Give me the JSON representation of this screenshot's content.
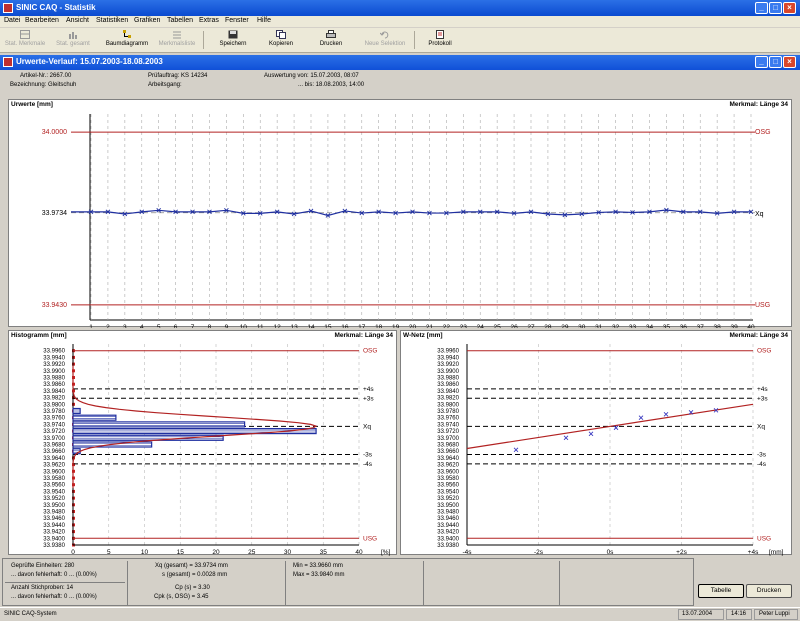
{
  "window": {
    "title": "SINIC CAQ - Statistik"
  },
  "menu": [
    "Datei",
    "Bearbeiten",
    "Ansicht",
    "Statistiken",
    "Grafiken",
    "Tabellen",
    "Extras",
    "Fenster",
    "Hilfe"
  ],
  "toolbar": [
    {
      "label": "Stat. Merkmale",
      "enabled": false,
      "icon": "table-icon"
    },
    {
      "label": "Stat. gesamt",
      "enabled": false,
      "icon": "chart-icon"
    },
    {
      "label": "Baumdiagramm",
      "enabled": true,
      "icon": "tree-icon"
    },
    {
      "label": "Merkmalsliste",
      "enabled": false,
      "icon": "list-icon"
    },
    {
      "label": "Speichern",
      "enabled": true,
      "icon": "save-icon"
    },
    {
      "label": "Kopieren",
      "enabled": true,
      "icon": "copy-icon"
    },
    {
      "label": "Drucken",
      "enabled": true,
      "icon": "print-icon"
    },
    {
      "label": "Neue Selektion",
      "enabled": false,
      "icon": "undo-icon"
    },
    {
      "label": "Protokoll",
      "enabled": true,
      "icon": "protocol-icon"
    }
  ],
  "subwindow": {
    "title": "Urwerte-Verlauf: 15.07.2003-18.08.2003"
  },
  "info": {
    "artikel": "Artikel-Nr.: 2667.00",
    "bezeichnung": "Bezeichnung: Gleitschuh",
    "pruefauftrag": "Prüfauftrag: KS 14234",
    "arbeitsgang": "Arbeitsgang:",
    "auswertung_von": "Auswertung von: 15.07.2003, 08:07",
    "auswertung_bis": "... bis: 18.08.2003, 14:00"
  },
  "urwerte": {
    "title": "Urwerte [mm]",
    "merkmal": "Merkmal: Länge 34",
    "osg_label": "OSG",
    "usg_label": "USG",
    "xq_label": "Xq",
    "y_labels": [
      "34.0000",
      "33.9734",
      "33.9430"
    ],
    "osg": 34.0,
    "usg": 33.943,
    "mean": 33.9734,
    "x_ticks": [
      "1",
      "2",
      "3",
      "4",
      "5",
      "6",
      "7",
      "8",
      "9",
      "10",
      "11",
      "12",
      "13",
      "14",
      "15",
      "16",
      "17",
      "18",
      "19",
      "20",
      "21",
      "22",
      "23",
      "24",
      "25",
      "26",
      "27",
      "28",
      "29",
      "30",
      "31",
      "32",
      "33",
      "34",
      "35",
      "36",
      "37",
      "38",
      "39",
      "40"
    ],
    "line_color": "#1f2fa0",
    "limit_color": "#b22222"
  },
  "histogramm": {
    "title": "Histogramm [mm]",
    "merkmal": "Merkmal: Länge 34",
    "y_labels": [
      "33.9960",
      "33.9940",
      "33.9920",
      "33.9900",
      "33.9880",
      "33.9860",
      "33.9840",
      "33.9820",
      "33.9800",
      "33.9780",
      "33.9760",
      "33.9740",
      "33.9720",
      "33.9700",
      "33.9680",
      "33.9660",
      "33.9640",
      "33.9620",
      "33.9600",
      "33.9580",
      "33.9560",
      "33.9540",
      "33.9520",
      "33.9500",
      "33.9480",
      "33.9460",
      "33.9440",
      "33.9420",
      "33.9400",
      "33.9380"
    ],
    "x_labels": [
      "0",
      "5",
      "10",
      "15",
      "20",
      "25",
      "30",
      "35",
      "40"
    ],
    "x_unit": "[%]",
    "markers": {
      "osg": "OSG",
      "p4s": "+4s",
      "p3s": "+3s",
      "xq": "Xq",
      "m3s": "-3s",
      "m4s": "-4s",
      "usg": "USG"
    }
  },
  "wnetz": {
    "title": "W-Netz [mm]",
    "merkmal": "Merkmal: Länge 34",
    "y_labels": [
      "33.9960",
      "33.9940",
      "33.9920",
      "33.9900",
      "33.9880",
      "33.9860",
      "33.9840",
      "33.9820",
      "33.9800",
      "33.9780",
      "33.9760",
      "33.9740",
      "33.9720",
      "33.9700",
      "33.9680",
      "33.9660",
      "33.9640",
      "33.9620",
      "33.9600",
      "33.9580",
      "33.9560",
      "33.9540",
      "33.9520",
      "33.9500",
      "33.9480",
      "33.9460",
      "33.9440",
      "33.9420",
      "33.9400",
      "33.9380"
    ],
    "x_labels": [
      "-4s",
      "-2s",
      "0s",
      "+2s",
      "+4s"
    ],
    "x_unit": "[mm]",
    "markers": {
      "osg": "OSG",
      "p4s": "+4s",
      "p3s": "+3s",
      "xq": "Xq",
      "m3s": "-3s",
      "m4s": "-4s",
      "usg": "USG"
    }
  },
  "chart_data": [
    {
      "type": "line",
      "title": "Urwerte [mm]",
      "x": [
        1,
        2,
        3,
        4,
        5,
        6,
        7,
        8,
        9,
        10,
        11,
        12,
        13,
        14,
        15,
        16,
        17,
        18,
        19,
        20,
        21,
        22,
        23,
        24,
        25,
        26,
        27,
        28,
        29,
        30,
        31,
        32,
        33,
        34,
        35,
        36,
        37,
        38,
        39,
        40
      ],
      "series": [
        {
          "values": [
            33.9737,
            33.9737,
            33.973,
            33.9737,
            33.9742,
            33.9737,
            33.9737,
            33.9737,
            33.9742,
            33.9732,
            33.9732,
            33.9737,
            33.973,
            33.974,
            33.9725,
            33.974,
            33.9733,
            33.9737,
            33.9733,
            33.9737,
            33.9733,
            33.9733,
            33.9737,
            33.9737,
            33.9737,
            33.9732,
            33.9737,
            33.973,
            33.9727,
            33.973,
            33.9735,
            33.9737,
            33.9735,
            33.9737,
            33.9743,
            33.9737,
            33.9737,
            33.9732,
            33.9737,
            33.9737
          ]
        }
      ],
      "ylim": [
        33.938,
        34.006
      ]
    },
    {
      "type": "bar",
      "title": "Histogramm [mm]",
      "categories": [
        "33.9780",
        "33.9760",
        "33.9740",
        "33.9720",
        "33.9700",
        "33.9680",
        "33.9660"
      ],
      "values": [
        1,
        6,
        24,
        34,
        21,
        11,
        1
      ],
      "xlim": [
        0,
        40
      ]
    },
    {
      "type": "scatter",
      "title": "W-Netz [mm]",
      "series": [
        {
          "values": [
            33.9664,
            33.97,
            33.9712,
            33.973,
            33.976,
            33.977,
            33.9776,
            33.9782
          ]
        }
      ],
      "ylim": [
        33.938,
        33.998
      ]
    }
  ],
  "stats": {
    "geprueft": "Geprüfte Einheiten: 280",
    "fehlerhaft1": "... davon fehlerhaft: 0 ... (0.00%)",
    "stichproben": "Anzahl Stichproben: 14",
    "fehlerhaft2": "... davon fehlerhaft: 0 ... (0.00%)",
    "xq": "Xq (gesamt) = 33.9734 mm",
    "s": "s (gesamt) = 0.0028 mm",
    "cp": "Cp (s) = 3.30",
    "cpk": "Cpk (s, OSG) = 3.45",
    "min": "Min = 33.9660 mm",
    "max": "Max = 33.9840 mm"
  },
  "buttons": {
    "tabelle": "Tabelle",
    "drucken": "Drucken"
  },
  "status": {
    "system": "SINIC CAQ-System",
    "date": "13.07.2004",
    "time": "14:16",
    "user": "Peter Luppi"
  }
}
